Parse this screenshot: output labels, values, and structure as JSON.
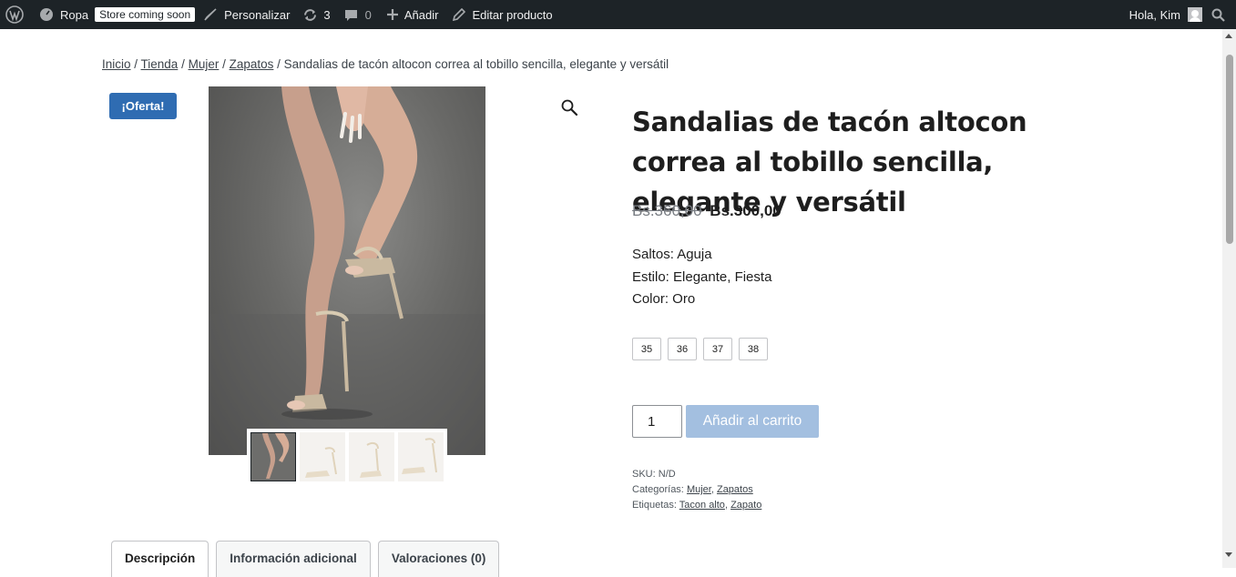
{
  "adminbar": {
    "site_name": "Ropa",
    "store_badge": "Store coming soon",
    "customize": "Personalizar",
    "updates_count": "3",
    "comments_count": "0",
    "add_new": "Añadir",
    "edit_product": "Editar producto",
    "greeting": "Hola, Kim"
  },
  "breadcrumb": {
    "items": [
      "Inicio",
      "Tienda",
      "Mujer",
      "Zapatos"
    ],
    "separator": " / ",
    "current": "Sandalias de tacón altocon correa al tobillo sencilla, elegante y versátil"
  },
  "product": {
    "sale_badge": "¡Oferta!",
    "title": "Sandalias de tacón altocon correa al tobillo sencilla, elegante y versátil",
    "price_old": "Bs.360,00",
    "price_new": "Bs.300,00",
    "description_lines": [
      "Saltos: Aguja",
      "Estilo: Elegante, Fiesta",
      "Color: Oro"
    ],
    "sizes": [
      "35",
      "36",
      "37",
      "38"
    ],
    "quantity": "1",
    "add_to_cart": "Añadir al carrito",
    "sku_label": "SKU:",
    "sku_value": "N/D",
    "categories_label": "Categorías:",
    "categories": [
      "Mujer",
      "Zapatos"
    ],
    "tags_label": "Etiquetas:",
    "tags": [
      "Tacon alto",
      "Zapato"
    ]
  },
  "tabs": [
    "Descripción",
    "Información adicional",
    "Valoraciones (0)"
  ],
  "colors": {
    "adminbar_bg": "#1d2327",
    "sale_badge_bg": "#2f6cb2",
    "add_to_cart_bg": "#a3bfe0"
  },
  "icons": [
    "wordpress-icon",
    "dashboard-icon",
    "brush-icon",
    "updates-icon",
    "comment-icon",
    "plus-icon",
    "pencil-icon",
    "search-icon",
    "zoom-icon"
  ]
}
